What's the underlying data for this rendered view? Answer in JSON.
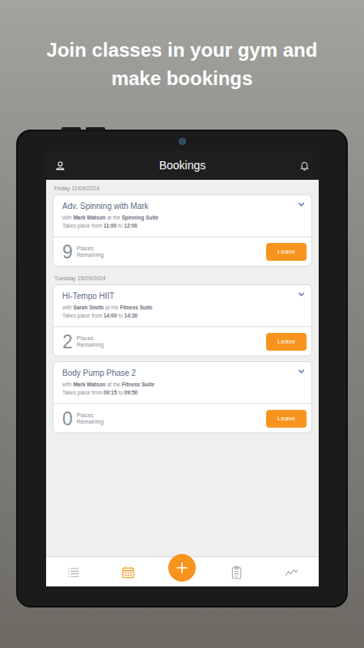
{
  "headline": "Join classes in your gym and make bookings",
  "app_bar": {
    "title": "Bookings"
  },
  "labels": {
    "with": "with",
    "at": "at the",
    "time": "Takes place from",
    "to": "to",
    "places": [
      "Places",
      "Remaining"
    ]
  },
  "groups": [
    {
      "date": "Friday 11/09/2024",
      "classes": [
        {
          "title": "Adv. Spinning with Mark",
          "instructor": "Mark Watson",
          "location": "Spinning Suite",
          "start": "11:00",
          "end": "12:00",
          "places": "9",
          "button": "Leave"
        }
      ]
    },
    {
      "date": "Tuesday 15/09/2024",
      "classes": [
        {
          "title": "Hi-Tempo HIIT",
          "instructor": "Sarah Smith",
          "location": "Fitness Suite",
          "start": "14:00",
          "end": "14:30",
          "places": "2",
          "button": "Leave"
        },
        {
          "title": "Body Pump Phase 2",
          "instructor": "Mark Watson",
          "location": "Fitness Suite",
          "start": "09:15",
          "end": "09:50",
          "places": "0",
          "button": "Leave"
        }
      ]
    }
  ],
  "nav": [
    {
      "kind": "list",
      "selected": false
    },
    {
      "kind": "calendar",
      "selected": true
    },
    {
      "kind": "add",
      "selected": false
    },
    {
      "kind": "clipboard",
      "selected": false
    },
    {
      "kind": "chart",
      "selected": false
    }
  ]
}
